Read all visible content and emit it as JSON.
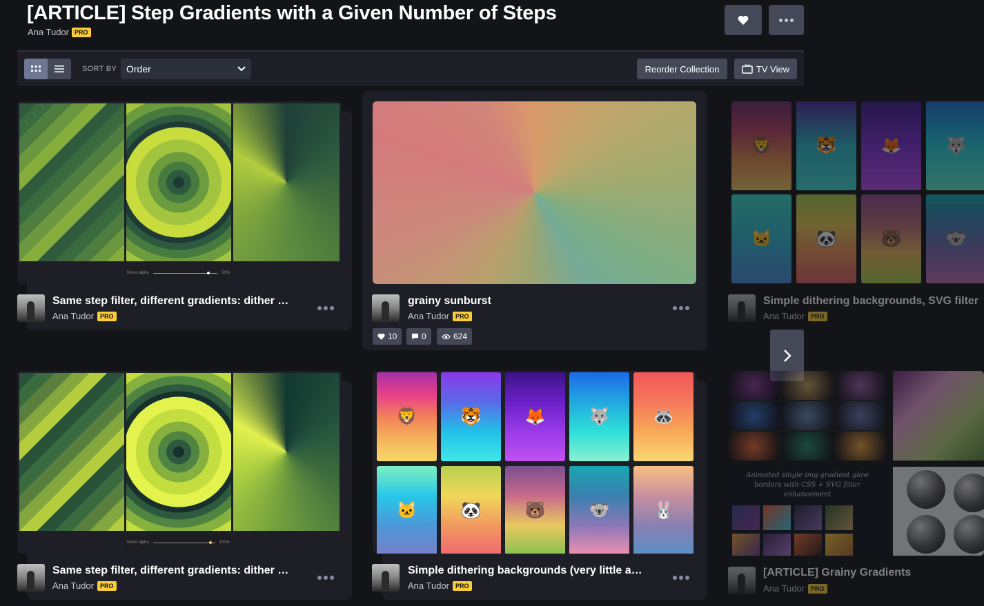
{
  "header": {
    "title": "[ARTICLE] Step Gradients with a Given Number of Steps",
    "author": "Ana Tudor",
    "badge": "PRO",
    "heart_icon": "heart-icon",
    "more_icon": "more-dots-icon"
  },
  "toolbar": {
    "sort_label": "SORT BY",
    "sort_value": "Order",
    "reorder_label": "Reorder Collection",
    "tv_label": "TV View"
  },
  "cards": [
    {
      "title": "Same step filter, different gradients: dither …",
      "author": "Ana Tudor",
      "badge": "PRO",
      "noise_label": "Noise alpha",
      "noise_value": "50%"
    },
    {
      "title": "grainy sunburst",
      "author": "Ana Tudor",
      "badge": "PRO",
      "likes": "10",
      "comments": "0",
      "views": "624"
    },
    {
      "title": "Simple dithering backgrounds, SVG filter",
      "author": "Ana Tudor",
      "badge": "PRO"
    },
    {
      "title": "Same step filter, different gradients: dither …",
      "author": "Ana Tudor",
      "badge": "PRO",
      "noise_label": "Noise alpha",
      "noise_value": "100%"
    },
    {
      "title": "Simple dithering backgrounds (very little a…",
      "author": "Ana Tudor",
      "badge": "PRO"
    },
    {
      "title": "[ARTICLE] Grainy Gradients",
      "author": "Ana Tudor",
      "badge": "PRO",
      "thumb_caption": "Animated single img gradient glow borders with CSS + SVG filter enhancement"
    }
  ],
  "animals": [
    "🦁",
    "🐯",
    "🦊",
    "🐺",
    "🦝",
    "🐱",
    "🐼",
    "🐻",
    "🐨",
    "🐰"
  ],
  "colors": {
    "accent": "#f9cc38",
    "button": "#444857",
    "panel": "#1e1f26",
    "bg": "#131417"
  }
}
